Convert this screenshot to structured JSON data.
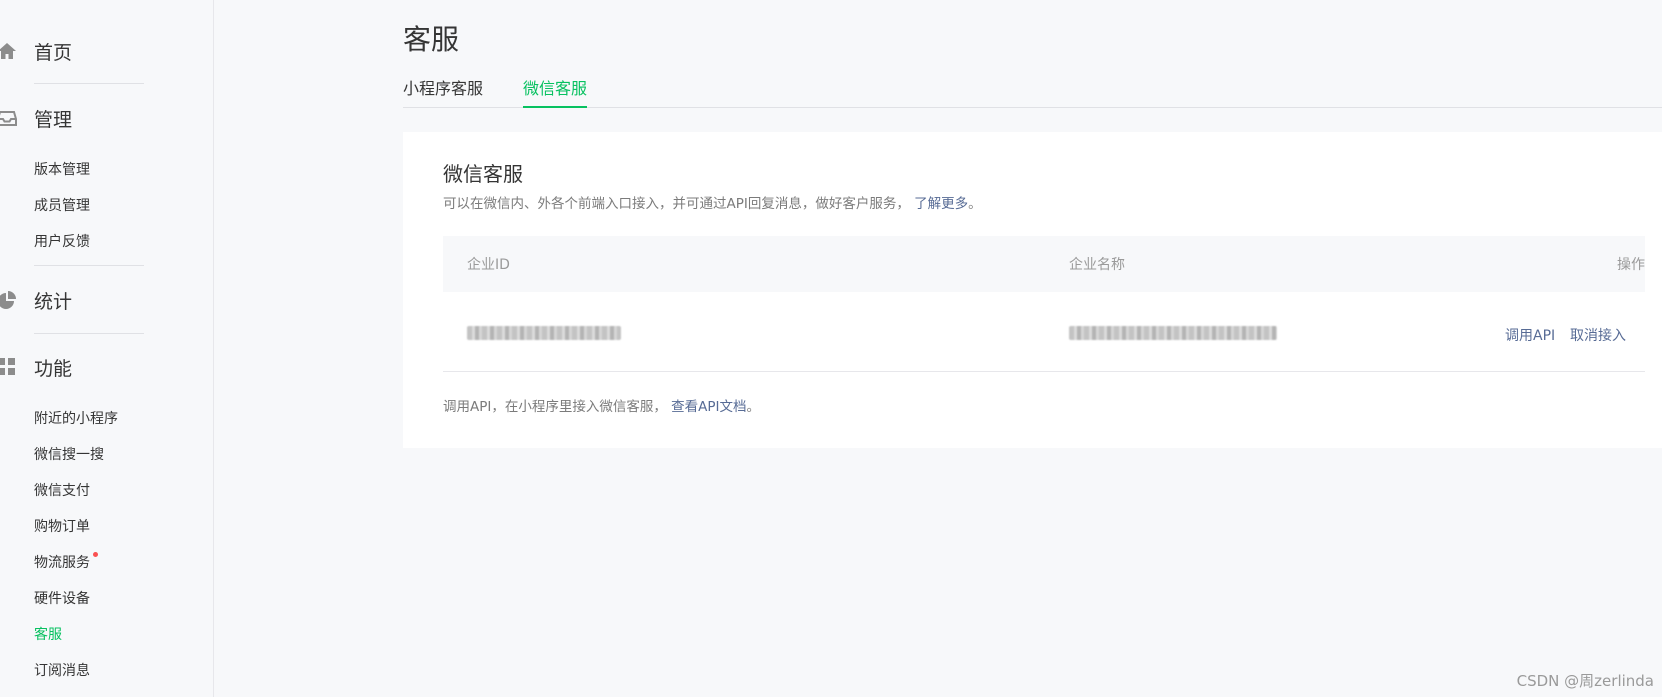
{
  "sidebar": {
    "groups": {
      "home": "首页",
      "manage": "管理",
      "stats": "统计",
      "features": "功能"
    },
    "manage_items": [
      "版本管理",
      "成员管理",
      "用户反馈"
    ],
    "feature_items": [
      "附近的小程序",
      "微信搜一搜",
      "微信支付",
      "购物订单",
      "物流服务",
      "硬件设备",
      "客服",
      "订阅消息"
    ],
    "active_item": "客服",
    "badge_item": "物流服务"
  },
  "page": {
    "title": "客服",
    "tabs": [
      "小程序客服",
      "微信客服"
    ],
    "active_tab": "微信客服"
  },
  "card": {
    "title": "微信客服",
    "desc": "可以在微信内、外各个前端入口接入，并可通过API回复消息，做好客户服务，",
    "desc_link": "了解更多",
    "desc_end": "。",
    "columns": {
      "id": "企业ID",
      "name": "企业名称",
      "ops": "操作"
    },
    "row": {
      "actions": [
        "调用API",
        "取消接入"
      ]
    },
    "foot": "调用API，在小程序里接入微信客服，",
    "foot_link": "查看API文档",
    "foot_end": "。"
  },
  "watermark": "CSDN @周zerlinda",
  "colors": {
    "accent": "#07c160",
    "link": "#576b95",
    "badge": "#fa5151"
  }
}
